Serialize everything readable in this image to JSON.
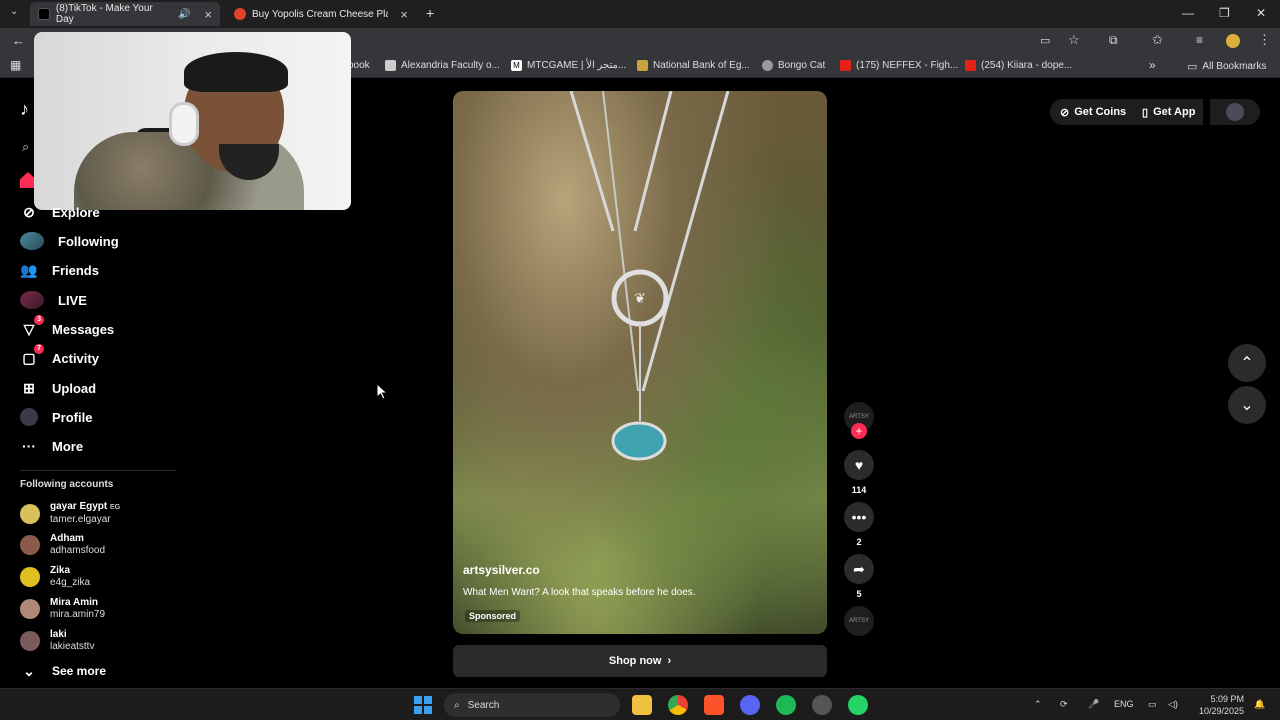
{
  "browser": {
    "tabs": [
      {
        "label": "(8)TikTok - Make Your Day",
        "active": true
      },
      {
        "label": "Buy Yopolis Cream Cheese Plain",
        "active": false
      }
    ],
    "bookmarks": [
      {
        "label": "book"
      },
      {
        "label": "Alexandria Faculty o..."
      },
      {
        "label": "MTCGAME | متجر الأ..."
      },
      {
        "label": "National Bank of Eg..."
      },
      {
        "label": "Bongo Cat"
      },
      {
        "label": "(175) NEFFEX - Figh..."
      },
      {
        "label": "(254) Kiiara - dope..."
      }
    ],
    "all_bookmarks": "All Bookmarks"
  },
  "sidebar": {
    "nav": [
      {
        "label": "Explore",
        "icon": "compass-icon"
      },
      {
        "label": "Following",
        "icon": "following-avatar-icon"
      },
      {
        "label": "Friends",
        "icon": "friends-icon"
      },
      {
        "label": "LIVE",
        "icon": "live-icon"
      },
      {
        "label": "Messages",
        "icon": "messages-icon",
        "badge": "3"
      },
      {
        "label": "Activity",
        "icon": "activity-icon",
        "badge": "7"
      },
      {
        "label": "Upload",
        "icon": "upload-icon"
      },
      {
        "label": "Profile",
        "icon": "profile-icon"
      },
      {
        "label": "More",
        "icon": "more-icon"
      }
    ],
    "following_header": "Following accounts",
    "accounts": [
      {
        "name": "gayar Egypt",
        "suffix": "EG",
        "handle": "tamer.elgayar"
      },
      {
        "name": "Adham",
        "handle": "adhamsfood"
      },
      {
        "name": "Zika",
        "handle": "e4g_zika"
      },
      {
        "name": "Mira Amin",
        "handle": "mira.amin79"
      },
      {
        "name": "laki",
        "handle": "lakieatsttv"
      }
    ],
    "see_more": "See more"
  },
  "header": {
    "get_coins": "Get Coins",
    "get_app": "Get App"
  },
  "video": {
    "author": "artsysilver.co",
    "caption": "What Men Want? A look that speaks before he does.",
    "sponsored": "Sponsored",
    "shop_now": "Shop now",
    "likes": "114",
    "comments": "2",
    "shares": "5",
    "avatar_text": "ARTSY"
  },
  "taskbar": {
    "search": "Search",
    "lang": "ENG",
    "time": "5:09 PM",
    "date": "10/29/2025"
  },
  "colors": {
    "accent": "#fe2c55",
    "bg": "#000000",
    "chrome": "#35363a"
  }
}
